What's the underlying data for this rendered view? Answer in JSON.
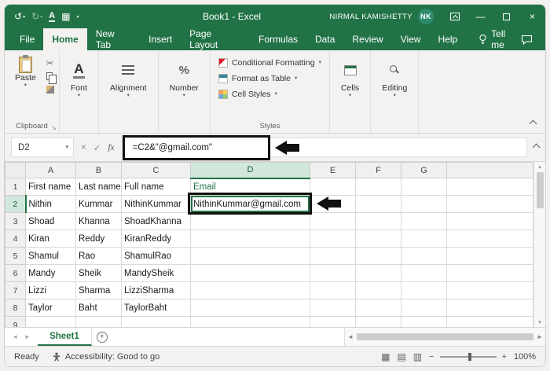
{
  "titlebar": {
    "title": "Book1 - Excel",
    "user_name": "NIRMAL KAMISHETTY",
    "user_initials": "NK"
  },
  "tabs": {
    "items": [
      "File",
      "Home",
      "New Tab",
      "Insert",
      "Page Layout",
      "Formulas",
      "Data",
      "Review",
      "View",
      "Help"
    ],
    "active": "Home",
    "tell_me": "Tell me"
  },
  "ribbon": {
    "paste_label": "Paste",
    "clipboard_label": "Clipboard",
    "font_label": "Font",
    "alignment_label": "Alignment",
    "number_label": "Number",
    "styles": {
      "conditional_formatting": "Conditional Formatting",
      "format_as_table": "Format as Table",
      "cell_styles": "Cell Styles",
      "label": "Styles"
    },
    "cells_label": "Cells",
    "editing_label": "Editing"
  },
  "formula_bar": {
    "name_box": "D2",
    "formula": "=C2&\"@gmail.com\""
  },
  "grid": {
    "columns": [
      "A",
      "B",
      "C",
      "D",
      "E",
      "F",
      "G"
    ],
    "selected_cell": {
      "col": "D",
      "row": 2
    },
    "accent_cell": {
      "col": "D",
      "row": 1
    },
    "rows": [
      [
        "First name",
        "Last name",
        "Full name",
        "Email",
        "",
        "",
        ""
      ],
      [
        "Nithin",
        "Kummar",
        "NithinKummar",
        "NithinKummar@gmail.com",
        "",
        "",
        ""
      ],
      [
        "Shoad",
        "Khanna",
        "ShoadKhanna",
        "",
        "",
        "",
        ""
      ],
      [
        "Kiran",
        "Reddy",
        "KiranReddy",
        "",
        "",
        "",
        ""
      ],
      [
        "Shamul",
        "Rao",
        "ShamulRao",
        "",
        "",
        "",
        ""
      ],
      [
        "Mandy",
        "Sheik",
        "MandySheik",
        "",
        "",
        "",
        ""
      ],
      [
        "Lizzi",
        "Sharma",
        "LizziSharma",
        "",
        "",
        "",
        ""
      ],
      [
        "Taylor",
        "Baht",
        "TaylorBaht",
        "",
        "",
        "",
        ""
      ],
      [
        "",
        "",
        "",
        "",
        "",
        "",
        ""
      ]
    ]
  },
  "sheet_bar": {
    "sheet_name": "Sheet1"
  },
  "status_bar": {
    "ready": "Ready",
    "accessibility": "Accessibility: Good to go",
    "zoom_level": "100%"
  },
  "colors": {
    "excel_green": "#217346",
    "selection_green": "#217346",
    "accent_text": "#217346",
    "annotation_black": "#111111"
  },
  "icons": {
    "undo": "↺",
    "redo": "↻",
    "underline_a": "A",
    "qat_table": "▦",
    "caret_down": "▾",
    "minimize": "—",
    "close": "×",
    "cut": "✂",
    "dialog_launcher": "↘",
    "cancel": "×",
    "check": "✓",
    "fx": "fx",
    "nav_left": "◂",
    "nav_right": "▸",
    "scroll_left": "◄",
    "scroll_right": "►",
    "scroll_up": "▴",
    "scroll_down": "▾",
    "new_sheet_plus": "+",
    "zoom_minus": "−",
    "zoom_plus": "+",
    "view_normal": "▦",
    "view_page_layout": "▤",
    "view_page_break": "▥",
    "percent": "%",
    "font_a": "A"
  }
}
